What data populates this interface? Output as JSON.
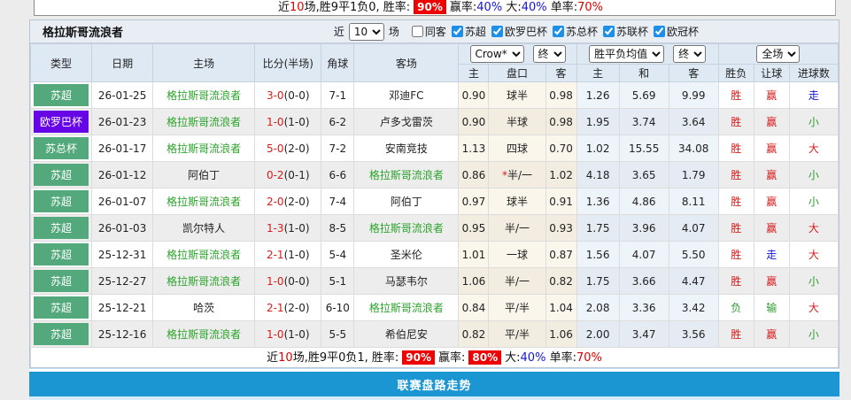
{
  "colors": {
    "badge_green": "#53a97c",
    "badge_purple": "#6606e6",
    "team_highlight_green": "#2ba32b",
    "result_red": "#d61b1b",
    "result_green": "#2e9e2e",
    "result_blue": "#1515dd",
    "rate_badge_red_bg": "#ee0202",
    "section_bar_blue": "#1b96d2"
  },
  "prev_table_summary": {
    "segments": [
      {
        "text": "近",
        "cls": "t"
      },
      {
        "text": "10",
        "cls": "red"
      },
      {
        "text": "场,胜9平1负0, 胜率:",
        "cls": "t"
      },
      {
        "text": "90%",
        "cls": "badge"
      },
      {
        "text": "赢率:",
        "cls": "t"
      },
      {
        "text": "40%",
        "cls": "blue"
      },
      {
        "text": " 大:",
        "cls": "t"
      },
      {
        "text": "40%",
        "cls": "blue"
      },
      {
        "text": " 单率:",
        "cls": "t"
      },
      {
        "text": "70%",
        "cls": "red"
      }
    ]
  },
  "panel": {
    "team_name": "格拉斯哥流浪者",
    "filter": {
      "near_label": "近",
      "near_count": "10",
      "games_label": "场",
      "checkboxes": [
        {
          "label": "同客",
          "checked": false
        },
        {
          "label": "苏超",
          "checked": true
        },
        {
          "label": "欧罗巴杯",
          "checked": true
        },
        {
          "label": "苏总杯",
          "checked": true
        },
        {
          "label": "苏联杯",
          "checked": true
        },
        {
          "label": "欧冠杯",
          "checked": true
        }
      ]
    },
    "selects": [
      "Crow*",
      "终",
      "胜平负均值",
      "终",
      "全场"
    ],
    "columns": [
      "类型",
      "日期",
      "主场",
      "比分(半场)",
      "角球",
      "客场",
      "主",
      "盘口",
      "客",
      "主",
      "和",
      "客",
      "胜负",
      "让球",
      "进球数"
    ],
    "rows": [
      {
        "type": "苏超",
        "type_color": "green",
        "date": "26-01-25",
        "home": "格拉斯哥流浪者",
        "home_highlight": true,
        "score_ft": "3-0",
        "score_ht": "(0-0)",
        "corner": "7-1",
        "away": "邓迪FC",
        "away_highlight": false,
        "ah_home": "0.90",
        "handicap": "球半",
        "handicap_star": false,
        "ah_away": "0.98",
        "eu_home": "1.26",
        "eu_draw": "5.69",
        "eu_away": "9.99",
        "result": "胜",
        "result_color": "red",
        "ah_result": "赢",
        "ah_result_color": "red",
        "goals": "走",
        "goals_color": "blue"
      },
      {
        "type": "欧罗巴杯",
        "type_color": "purple",
        "date": "26-01-23",
        "home": "格拉斯哥流浪者",
        "home_highlight": true,
        "score_ft": "1-0",
        "score_ht": "(1-0)",
        "corner": "6-2",
        "away": "卢多戈雷茨",
        "away_highlight": false,
        "ah_home": "0.90",
        "handicap": "半球",
        "handicap_star": false,
        "ah_away": "0.98",
        "eu_home": "1.95",
        "eu_draw": "3.74",
        "eu_away": "3.64",
        "result": "胜",
        "result_color": "red",
        "ah_result": "赢",
        "ah_result_color": "red",
        "goals": "小",
        "goals_color": "green"
      },
      {
        "type": "苏总杯",
        "type_color": "green",
        "date": "26-01-17",
        "home": "格拉斯哥流浪者",
        "home_highlight": true,
        "score_ft": "5-0",
        "score_ht": "(2-0)",
        "corner": "7-2",
        "away": "安南竞技",
        "away_highlight": false,
        "ah_home": "1.13",
        "handicap": "四球",
        "handicap_star": false,
        "ah_away": "0.70",
        "eu_home": "1.02",
        "eu_draw": "15.55",
        "eu_away": "34.08",
        "result": "胜",
        "result_color": "red",
        "ah_result": "赢",
        "ah_result_color": "red",
        "goals": "大",
        "goals_color": "red"
      },
      {
        "type": "苏超",
        "type_color": "green",
        "date": "26-01-12",
        "home": "阿伯丁",
        "home_highlight": false,
        "score_ft": "0-2",
        "score_ht": "(0-1)",
        "corner": "6-6",
        "away": "格拉斯哥流浪者",
        "away_highlight": true,
        "ah_home": "0.86",
        "handicap": "半/一",
        "handicap_star": true,
        "ah_away": "1.02",
        "eu_home": "4.18",
        "eu_draw": "3.65",
        "eu_away": "1.79",
        "result": "胜",
        "result_color": "red",
        "ah_result": "赢",
        "ah_result_color": "red",
        "goals": "小",
        "goals_color": "green"
      },
      {
        "type": "苏超",
        "type_color": "green",
        "date": "26-01-07",
        "home": "格拉斯哥流浪者",
        "home_highlight": true,
        "score_ft": "2-0",
        "score_ht": "(2-0)",
        "corner": "7-4",
        "away": "阿伯丁",
        "away_highlight": false,
        "ah_home": "0.97",
        "handicap": "球半",
        "handicap_star": false,
        "ah_away": "0.91",
        "eu_home": "1.36",
        "eu_draw": "4.86",
        "eu_away": "8.11",
        "result": "胜",
        "result_color": "red",
        "ah_result": "赢",
        "ah_result_color": "red",
        "goals": "小",
        "goals_color": "green"
      },
      {
        "type": "苏超",
        "type_color": "green",
        "date": "26-01-03",
        "home": "凯尔特人",
        "home_highlight": false,
        "score_ft": "1-3",
        "score_ht": "(1-0)",
        "corner": "8-5",
        "away": "格拉斯哥流浪者",
        "away_highlight": true,
        "ah_home": "0.95",
        "handicap": "半/一",
        "handicap_star": false,
        "ah_away": "0.93",
        "eu_home": "1.75",
        "eu_draw": "3.96",
        "eu_away": "4.07",
        "result": "胜",
        "result_color": "red",
        "ah_result": "赢",
        "ah_result_color": "red",
        "goals": "大",
        "goals_color": "red"
      },
      {
        "type": "苏超",
        "type_color": "green",
        "date": "25-12-31",
        "home": "格拉斯哥流浪者",
        "home_highlight": true,
        "score_ft": "2-1",
        "score_ht": "(1-0)",
        "corner": "5-4",
        "away": "圣米伦",
        "away_highlight": false,
        "ah_home": "1.01",
        "handicap": "一球",
        "handicap_star": false,
        "ah_away": "0.87",
        "eu_home": "1.56",
        "eu_draw": "4.07",
        "eu_away": "5.50",
        "result": "胜",
        "result_color": "red",
        "ah_result": "走",
        "ah_result_color": "blue",
        "goals": "大",
        "goals_color": "red"
      },
      {
        "type": "苏超",
        "type_color": "green",
        "date": "25-12-27",
        "home": "格拉斯哥流浪者",
        "home_highlight": true,
        "score_ft": "1-0",
        "score_ht": "(0-0)",
        "corner": "5-1",
        "away": "马瑟韦尔",
        "away_highlight": false,
        "ah_home": "1.06",
        "handicap": "半/一",
        "handicap_star": false,
        "ah_away": "0.82",
        "eu_home": "1.75",
        "eu_draw": "3.66",
        "eu_away": "4.47",
        "result": "胜",
        "result_color": "red",
        "ah_result": "赢",
        "ah_result_color": "red",
        "goals": "小",
        "goals_color": "green"
      },
      {
        "type": "苏超",
        "type_color": "green",
        "date": "25-12-21",
        "home": "哈茨",
        "home_highlight": false,
        "score_ft": "2-1",
        "score_ht": "(2-0)",
        "corner": "6-10",
        "away": "格拉斯哥流浪者",
        "away_highlight": true,
        "ah_home": "0.84",
        "handicap": "平/半",
        "handicap_star": false,
        "ah_away": "1.04",
        "eu_home": "2.08",
        "eu_draw": "3.36",
        "eu_away": "3.42",
        "result": "负",
        "result_color": "green",
        "ah_result": "输",
        "ah_result_color": "green",
        "goals": "大",
        "goals_color": "red"
      },
      {
        "type": "苏超",
        "type_color": "green",
        "date": "25-12-16",
        "home": "格拉斯哥流浪者",
        "home_highlight": true,
        "score_ft": "1-0",
        "score_ht": "(1-0)",
        "corner": "5-5",
        "away": "希伯尼安",
        "away_highlight": false,
        "ah_home": "0.82",
        "handicap": "平/半",
        "handicap_star": false,
        "ah_away": "1.06",
        "eu_home": "2.00",
        "eu_draw": "3.47",
        "eu_away": "3.56",
        "result": "胜",
        "result_color": "red",
        "ah_result": "赢",
        "ah_result_color": "red",
        "goals": "小",
        "goals_color": "green"
      }
    ],
    "summary": {
      "segments": [
        {
          "text": "近",
          "cls": "t"
        },
        {
          "text": "10",
          "cls": "red"
        },
        {
          "text": "场,胜9平0负1, 胜率:",
          "cls": "t"
        },
        {
          "text": "90%",
          "cls": "badge"
        },
        {
          "text": "赢率:",
          "cls": "t"
        },
        {
          "text": "80%",
          "cls": "badge"
        },
        {
          "text": "大:",
          "cls": "t"
        },
        {
          "text": "40%",
          "cls": "blue"
        },
        {
          "text": " 单率:",
          "cls": "t"
        },
        {
          "text": "70%",
          "cls": "red"
        }
      ]
    }
  },
  "footer_bar": {
    "label": "联赛盘路走势"
  }
}
